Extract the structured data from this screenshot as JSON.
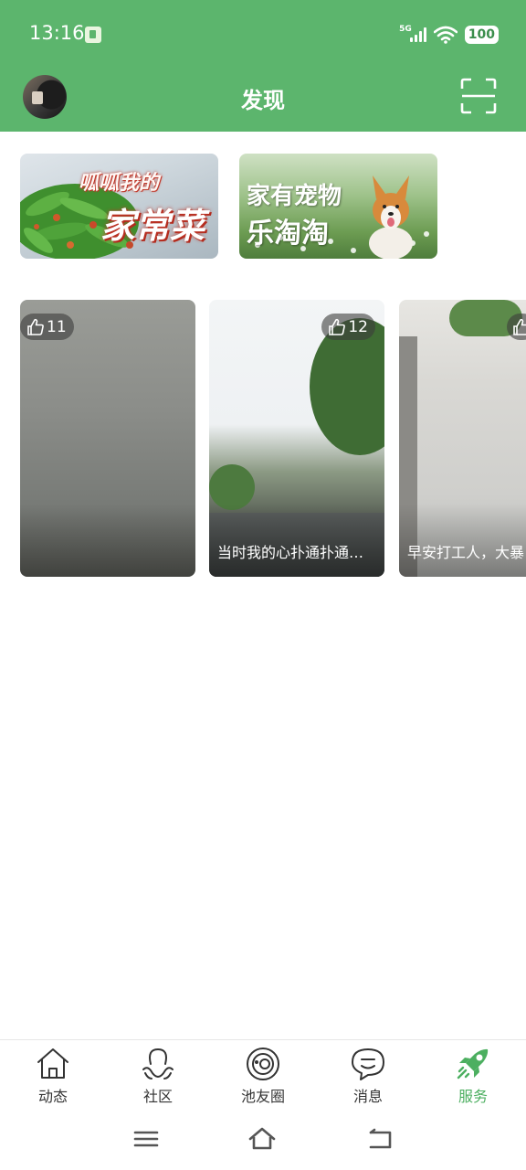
{
  "status_bar": {
    "time": "13:16",
    "network": "5G",
    "battery": "100"
  },
  "header": {
    "title": "发现",
    "icons": {
      "avatar": "user-avatar",
      "scan": "scan-icon"
    }
  },
  "banners": [
    {
      "line1": "呱呱我的",
      "line2": "家常菜",
      "image": "snow-peas-dish"
    },
    {
      "line1": "家有宠物",
      "line2": "乐淘淘",
      "image": "corgi-in-flower-field"
    }
  ],
  "cards": [
    {
      "likes": "11",
      "caption": "",
      "image": "flooded-water-surface"
    },
    {
      "likes": "12",
      "caption": "当时我的心扑通扑通…",
      "image": "city-road-with-trees"
    },
    {
      "likes": "",
      "caption": "早安打工人，大暴",
      "image": "rainy-street"
    }
  ],
  "bottom_nav": [
    {
      "label": "动态",
      "icon": "home-icon",
      "active": false
    },
    {
      "label": "社区",
      "icon": "community-icon",
      "active": false
    },
    {
      "label": "池友圈",
      "icon": "circle-icon",
      "active": false
    },
    {
      "label": "消息",
      "icon": "message-icon",
      "active": false
    },
    {
      "label": "服务",
      "icon": "rocket-icon",
      "active": true
    }
  ],
  "colors": {
    "brand_green": "#5cb56d",
    "active_green": "#4caf60",
    "nav_text": "#333333"
  },
  "system_nav": {
    "icons": [
      "menu-icon",
      "home-outline-icon",
      "back-icon"
    ]
  }
}
